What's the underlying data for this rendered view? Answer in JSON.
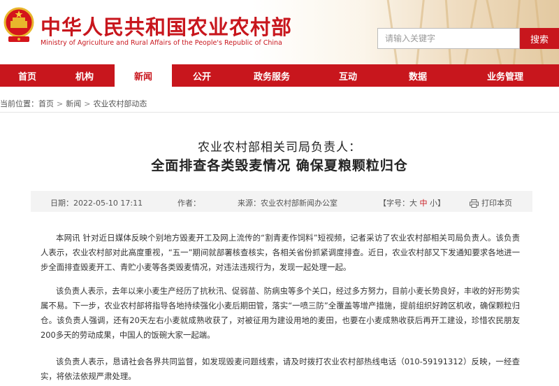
{
  "header": {
    "title_cn": "中华人民共和国农业农村部",
    "title_en": "Ministry of Agriculture and Rural Affairs of the People's Republic of China",
    "emblem_icon": "national-emblem-icon",
    "brand_color": "#c8161d"
  },
  "search": {
    "placeholder": "请输入关键字",
    "button_label": "搜索"
  },
  "nav": {
    "items": [
      {
        "label": "首页"
      },
      {
        "label": "机构"
      },
      {
        "label": "新闻",
        "active": true
      },
      {
        "label": "公开"
      },
      {
        "label": "政务服务"
      },
      {
        "label": "互动"
      },
      {
        "label": "数据"
      },
      {
        "label": "业务管理"
      }
    ]
  },
  "breadcrumb": {
    "prefix": "当前位置：",
    "items": [
      "首页",
      "新闻",
      "农业农村部动态"
    ],
    "separator": ">"
  },
  "article": {
    "title_line1": "农业农村部相关司局负责人：",
    "title_line2": "全面排查各类毁麦情况  确保夏粮颗粒归仓",
    "meta": {
      "date_label": "日期：",
      "date": "2022-05-10 17:11",
      "author_label": "作者：",
      "source_label": "来源：",
      "source": "农业农村部新闻办公室",
      "font_size_label": "【字号：",
      "font_large": "大",
      "font_medium": "中",
      "font_small": "小",
      "font_size_end": "】",
      "print_label": "打印本页"
    },
    "paragraphs": [
      "本网讯 针对近日媒体反映个别地方毁麦开工及网上流传的“割青麦作饲料”短视频，记者采访了农业农村部相关司局负责人。该负责人表示，农业农村部对此高度重视，“五一”期间就部署核查核实，各相关省份抓紧调度排查。近日，农业农村部又下发通知要求各地进一步全面排查毁麦开工、青贮小麦等各类毁麦情况，对违法违规行为，发现一起处理一起。",
      "该负责人表示，去年以来小麦生产经历了抗秋汛、促弱苗、防病虫等多个关口，经过多方努力，目前小麦长势良好，丰收的好形势实属不易。下一步，农业农村部将指导各地持续强化小麦后期田管，落实“一喷三防”全覆盖等增产措施，提前组织好跨区机收，确保颗粒归仓。该负责人强调，还有20天左右小麦就成熟收获了，对被征用为建设用地的麦田，也要在小麦成熟收获后再开工建设，珍惜农民朋友200多天的劳动成果，中国人的饭碗大家一起端。",
      "该负责人表示，恳请社会各界共同监督，如发现毁麦问题线索，请及时拨打农业农村部热线电话（010-59191312）反映，一经查实，将依法依规严肃处理。"
    ]
  }
}
